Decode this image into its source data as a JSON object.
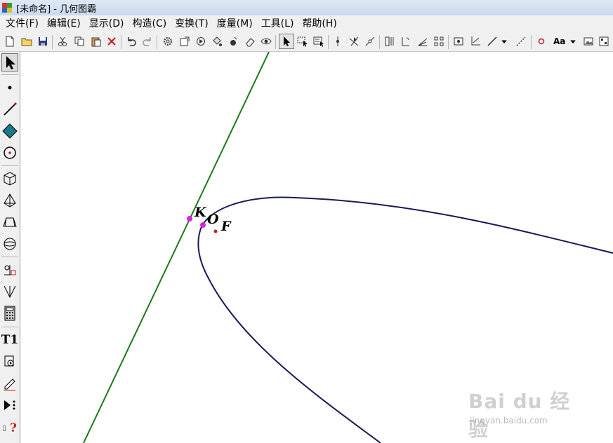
{
  "window": {
    "title": "[未命名] - 几何图霸"
  },
  "menu": [
    "文件(F)",
    "编辑(E)",
    "显示(D)",
    "构造(C)",
    "变换(T)",
    "度量(M)",
    "工具(L)",
    "帮助(H)"
  ],
  "toolbar": {
    "font_button_label": "Aa"
  },
  "sidebar": {
    "text_tool_label": "T1",
    "help_tool_label": "?"
  },
  "canvas": {
    "points": [
      {
        "label": "K",
        "color": "#e020e0"
      },
      {
        "label": "O",
        "color": "#e020e0"
      },
      {
        "label": "F",
        "color": "#c82020"
      }
    ],
    "line_color": "#1a7a1a",
    "curve_color": "#1a1a5a"
  },
  "watermark": {
    "main": "Bai du 经验",
    "sub": "jingyan.baidu.com"
  }
}
